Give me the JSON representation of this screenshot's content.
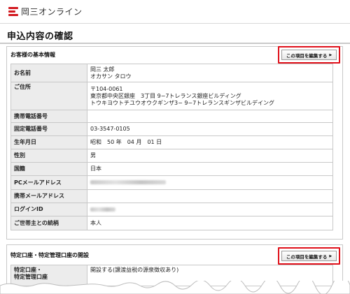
{
  "header": {
    "logo_text": "岡三オンライン",
    "brand_color": "#d2171e"
  },
  "page_title": "申込内容の確認",
  "edit_button_label": "この項目を編集する",
  "section_basic": {
    "title": "お客様の基本情報",
    "rows": [
      {
        "label": "お名前",
        "lines": [
          "岡三 太郎",
          "オカサン タロウ"
        ]
      },
      {
        "label": "ご住所",
        "lines": [
          "〒104-0061",
          "東京都中央区銀座　3丁目 9−7トレランス銀座ビルディング",
          "トウキヨウトチユウオウクギンザ3− 9−7トレランスギンザビルデイング"
        ]
      },
      {
        "label": "携帯電話番号",
        "lines": [
          ""
        ]
      },
      {
        "label": "固定電話番号",
        "lines": [
          "03-3547-0105"
        ]
      },
      {
        "label": "生年月日",
        "lines": [
          "昭和　50 年　04 月　01 日"
        ]
      },
      {
        "label": "性別",
        "lines": [
          "男"
        ]
      },
      {
        "label": "国籍",
        "lines": [
          "日本"
        ]
      },
      {
        "label": "PCメールアドレス",
        "lines": [
          ""
        ],
        "obscured": true
      },
      {
        "label": "携帯メールアドレス",
        "lines": [
          ""
        ]
      },
      {
        "label": "ログインID",
        "lines": [
          ""
        ],
        "obscured": true
      },
      {
        "label": "ご世帯主との続柄",
        "lines": [
          "本人"
        ]
      }
    ]
  },
  "section_tokutei": {
    "title": "特定口座・特定管理口座の開設",
    "rows": [
      {
        "label_lines": [
          "特定口座・",
          "特定管理口座"
        ],
        "value": "開設する(譲渡益税の源泉徴収あり)"
      }
    ]
  }
}
